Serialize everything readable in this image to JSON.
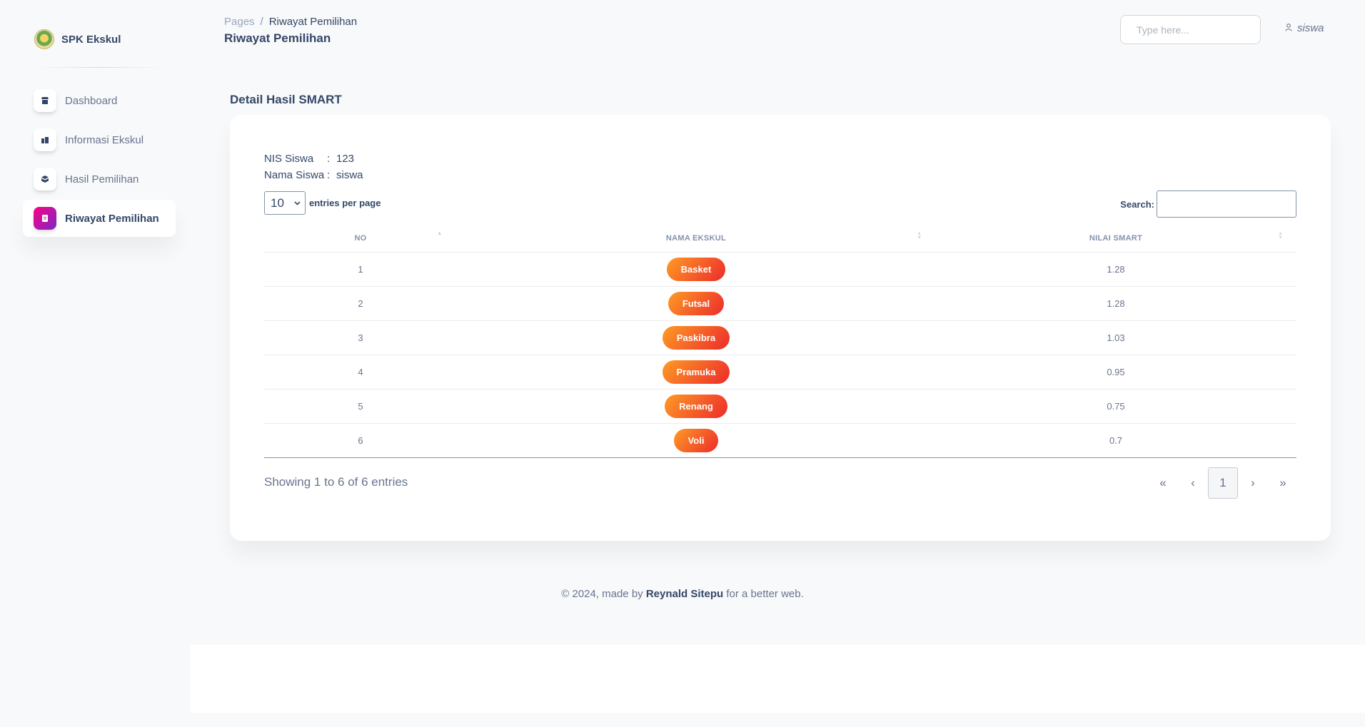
{
  "sidebar": {
    "brand": "SPK Ekskul",
    "items": [
      {
        "label": "Dashboard",
        "icon": "shop-icon"
      },
      {
        "label": "Informasi Ekskul",
        "icon": "building-icon"
      },
      {
        "label": "Hasil Pemilihan",
        "icon": "box-icon"
      },
      {
        "label": "Riwayat Pemilihan",
        "icon": "document-icon",
        "active": true
      }
    ]
  },
  "header": {
    "breadcrumb_root": "Pages",
    "breadcrumb_sep": "/",
    "breadcrumb_current": "Riwayat Pemilihan",
    "title": "Riwayat Pemilihan",
    "search_placeholder": "Type here...",
    "user": "siswa"
  },
  "main": {
    "section_title": "Detail Hasil SMART",
    "student": {
      "nis_label": "NIS Siswa",
      "nis_value": "123",
      "nama_label": "Nama Siswa",
      "nama_value": "siswa",
      "colon": ":"
    },
    "entries_value": "10",
    "entries_label": "entries per page",
    "search_label": "Search:",
    "table": {
      "headers": [
        "NO",
        "NAMA EKSKUL",
        "NILAI SMART"
      ],
      "rows": [
        {
          "no": "1",
          "nama": "Basket",
          "nilai": "1.28"
        },
        {
          "no": "2",
          "nama": "Futsal",
          "nilai": "1.28"
        },
        {
          "no": "3",
          "nama": "Paskibra",
          "nilai": "1.03"
        },
        {
          "no": "4",
          "nama": "Pramuka",
          "nilai": "0.95"
        },
        {
          "no": "5",
          "nama": "Renang",
          "nilai": "0.75"
        },
        {
          "no": "6",
          "nama": "Voli",
          "nilai": "0.7"
        }
      ]
    },
    "showing": "Showing 1 to 6 of 6 entries",
    "pagination": {
      "first": "«",
      "prev": "‹",
      "current": "1",
      "next": "›",
      "last": "»"
    }
  },
  "footer": {
    "prefix": "© 2024, made by",
    "author": "Reynald Sitepu",
    "suffix": "for a better web."
  },
  "colors": {
    "active_gradient": [
      "#7928ca",
      "#ff0080"
    ],
    "badge_gradient": [
      "#ea0606",
      "#ff8a00"
    ],
    "heading": "#344767",
    "text": "#67748e"
  }
}
